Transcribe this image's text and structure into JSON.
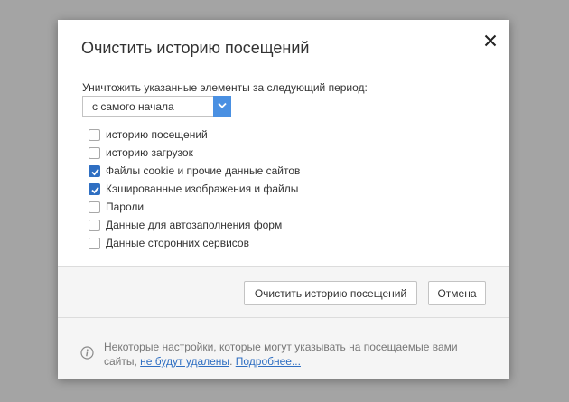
{
  "dialog": {
    "title": "Очистить историю посещений",
    "period_label": "Уничтожить указанные элементы за следующий период:",
    "period_selected": "с самого начала",
    "options": [
      {
        "label": "историю посещений",
        "checked": false
      },
      {
        "label": "историю загрузок",
        "checked": false
      },
      {
        "label": "Файлы cookie и прочие данные сайтов",
        "checked": true
      },
      {
        "label": "Кэшированные изображения и файлы",
        "checked": true
      },
      {
        "label": "Пароли",
        "checked": false
      },
      {
        "label": "Данные для автозаполнения форм",
        "checked": false
      },
      {
        "label": "Данные сторонних сервисов",
        "checked": false
      }
    ],
    "clear_button": "Очистить историю посещений",
    "cancel_button": "Отмена",
    "info": {
      "text_before": "Некоторые настройки, которые могут указывать на посещаемые вами сайты, ",
      "link1": "не будут удалены",
      "text_middle": ". ",
      "link2": "Подробнее..."
    }
  },
  "colors": {
    "accent": "#4a90e2",
    "checkbox_checked": "#2f6fc2",
    "overlay": "#a4a4a4"
  },
  "icons": {
    "close": "close-icon",
    "dropdown": "chevron-down-icon",
    "check": "check-icon",
    "info": "info-icon"
  }
}
